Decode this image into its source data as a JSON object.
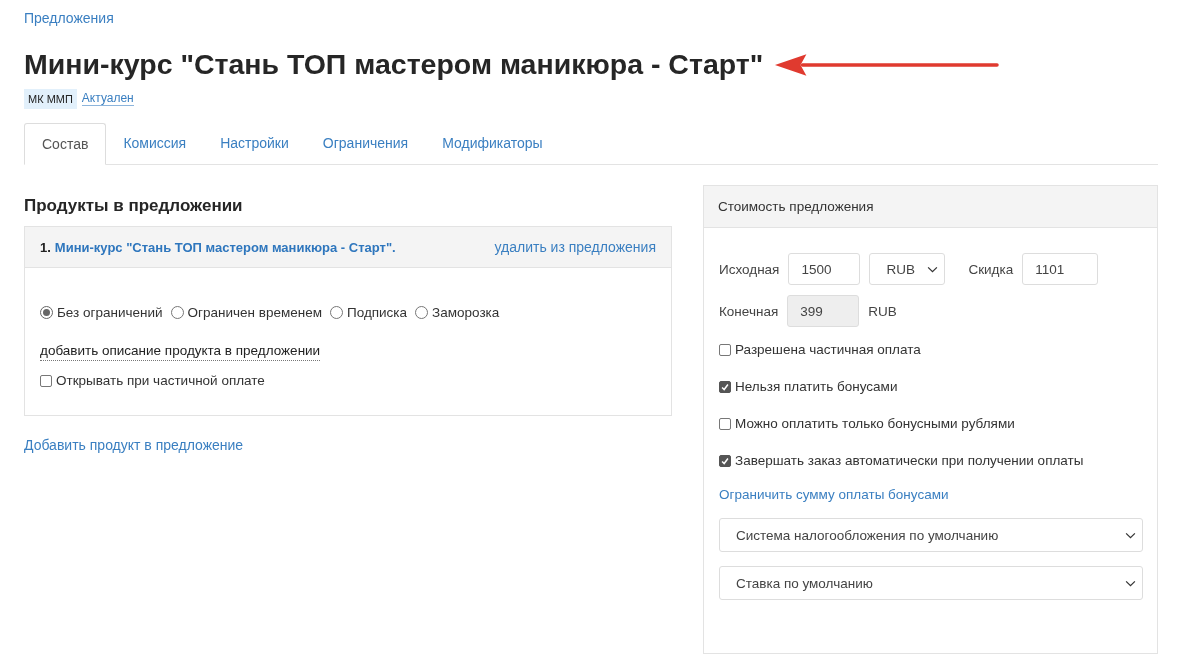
{
  "breadcrumb": "Предложения",
  "title": "Мини-курс \"Стань ТОП мастером маникюра - Старт\"",
  "tags": [
    {
      "kind": "label",
      "text": "МК ММП"
    },
    {
      "kind": "link",
      "text": "Актуален"
    }
  ],
  "tabs": [
    {
      "label": "Состав",
      "selected": true
    },
    {
      "label": "Комиссия",
      "selected": false
    },
    {
      "label": "Настройки",
      "selected": false
    },
    {
      "label": "Ограничения",
      "selected": false
    },
    {
      "label": "Модификаторы",
      "selected": false
    }
  ],
  "products": {
    "heading": "Продукты в предложении",
    "items": [
      {
        "number": "1.",
        "name": "Мини-курс \"Стань ТОП мастером маникюра - Старт\".",
        "remove_link": "удалить из предложения",
        "access_options": [
          {
            "label": "Без ограничений",
            "selected": true
          },
          {
            "label": "Ограничен временем",
            "selected": false
          },
          {
            "label": "Подписка",
            "selected": false
          },
          {
            "label": "Заморозка",
            "selected": false
          }
        ],
        "description_link": "добавить описание продукта в предложении",
        "partial_open": {
          "label": "Открывать при частичной оплате",
          "checked": false
        }
      }
    ],
    "add_link": "Добавить продукт в предложение"
  },
  "price": {
    "title": "Стоимость предложения",
    "original": {
      "label": "Исходная",
      "value": "1500"
    },
    "currency": "RUB",
    "discount": {
      "label": "Скидка",
      "value": "1101"
    },
    "final": {
      "label": "Конечная",
      "value": "399",
      "currency": "RUB"
    },
    "options": [
      {
        "label": "Разрешена частичная оплата",
        "checked": false
      },
      {
        "label": "Нельзя платить бонусами",
        "checked": true
      },
      {
        "label": "Можно оплатить только бонусными рублями",
        "checked": false
      },
      {
        "label": "Завершать заказ автоматически при получении оплаты",
        "checked": true
      }
    ],
    "bonus_limit_link": "Ограничить сумму оплаты бонусами",
    "selects": [
      {
        "value": "Система налогообложения по умолчанию"
      },
      {
        "value": "Ставка по умолчанию"
      }
    ]
  }
}
